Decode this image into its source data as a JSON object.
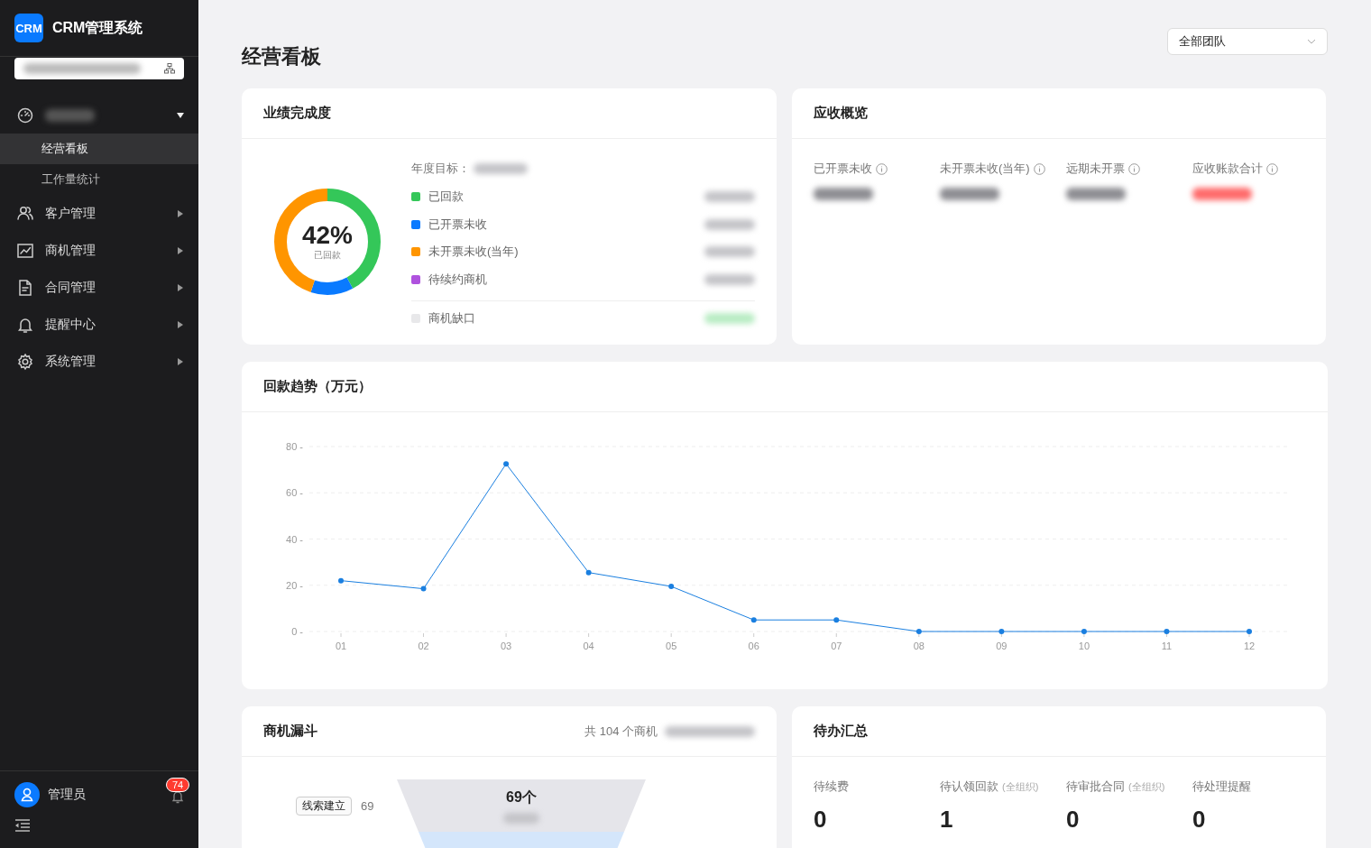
{
  "sidebar": {
    "logo": "CRM",
    "app_name": "CRM管理系统",
    "menu": [
      {
        "expanded": true,
        "children": [
          {
            "label": "经营看板",
            "selected": true
          },
          {
            "label": "工作量统计",
            "selected": false
          }
        ]
      },
      {
        "label": "客户管理",
        "expanded": false
      },
      {
        "label": "商机管理",
        "expanded": false
      },
      {
        "label": "合同管理",
        "expanded": false
      },
      {
        "label": "提醒中心",
        "expanded": false
      },
      {
        "label": "系统管理",
        "expanded": false
      }
    ],
    "user": {
      "name": "管理员",
      "notifications": "74"
    }
  },
  "header": {
    "title": "经营看板",
    "team_select": {
      "value": "全部团队"
    }
  },
  "performance": {
    "title": "业绩完成度",
    "percent": "42%",
    "percent_label": "已回款",
    "target_label": "年度目标：",
    "legend": [
      {
        "label": "已回款",
        "color": "#34c759",
        "level": 0.42
      },
      {
        "label": "已开票未收",
        "color": "#0a7aff",
        "level": 0.13
      },
      {
        "label": "未开票未收(当年)",
        "color": "#ff9500",
        "level": 0.45
      },
      {
        "label": "待续约商机",
        "color": "#af52de",
        "level": 0
      }
    ],
    "gap_item": {
      "label": "商机缺口",
      "color": "#e8e8ea"
    }
  },
  "receivables": {
    "title": "应收概览",
    "items": [
      {
        "label": "已开票未收",
        "color": "#8e8e93"
      },
      {
        "label": "未开票未收(当年)",
        "color": "#8e8e93"
      },
      {
        "label": "远期未开票",
        "color": "#8e8e93"
      },
      {
        "label": "应收账款合计",
        "color": "#ff6b6b"
      }
    ]
  },
  "trend": {
    "title": "回款趋势（万元）",
    "chart_data": {
      "type": "line",
      "categories": [
        "01",
        "02",
        "03",
        "04",
        "05",
        "06",
        "07",
        "08",
        "09",
        "10",
        "11",
        "12"
      ],
      "series": [
        {
          "color": "#1a7fe0",
          "marker": "circle",
          "values": [
            22,
            18.5,
            72.5,
            25.5,
            19.5,
            5,
            5,
            0,
            0,
            0,
            0,
            0
          ]
        }
      ],
      "ylim": [
        0,
        80
      ],
      "grid": true,
      "yticks": [
        {
          "value": 0,
          "label": "0 -"
        },
        {
          "value": 20,
          "label": "20 -"
        },
        {
          "value": 40,
          "label": "40 -"
        },
        {
          "value": 60,
          "label": "60 -"
        },
        {
          "value": 80,
          "label": "80 -"
        }
      ]
    }
  },
  "funnel": {
    "title": "商机漏斗",
    "total": "共 104 个商机",
    "stages": [
      {
        "label": "线索建立",
        "count": "69",
        "value": "69个",
        "color": "#e5e5ea"
      },
      {
        "color": "#d4e6fb"
      }
    ]
  },
  "todo": {
    "title": "待办汇总",
    "items": [
      {
        "label": "待续费",
        "value": "0"
      },
      {
        "label": "待认领回款",
        "scope": "(全组织)",
        "value": "1"
      },
      {
        "label": "待审批合同",
        "scope": "(全组织)",
        "value": "0"
      },
      {
        "label": "待处理提醒",
        "value": "0"
      }
    ]
  }
}
